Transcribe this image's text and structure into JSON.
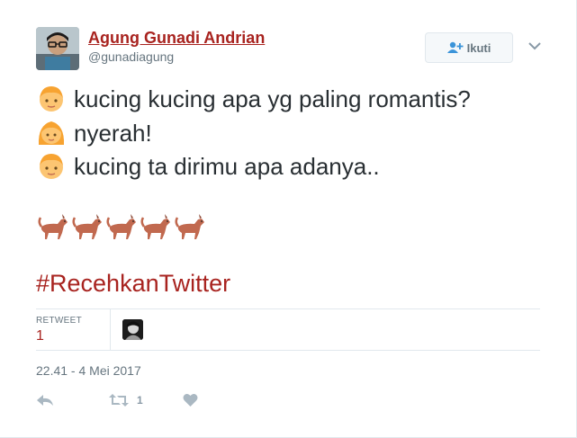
{
  "tweet": {
    "author": {
      "name": "Agung Gunadi Andrian",
      "handle": "@gunadiagung"
    },
    "follow_button": {
      "label": "Ikuti",
      "icon": "add-user-icon"
    },
    "lines": [
      {
        "emoji": "boy-emoji",
        "text": "kucing kucing apa yg paling romantis?"
      },
      {
        "emoji": "girl-emoji",
        "text": "nyerah!"
      },
      {
        "emoji": "boy-emoji",
        "text": "kucing ta dirimu apa adanya.."
      }
    ],
    "dog_emojis": [
      "dog-emoji",
      "dog-emoji",
      "dog-emoji",
      "dog-emoji",
      "dog-emoji"
    ],
    "hashtag": "#RecehkanTwitter",
    "stats": {
      "retweet_label": "RETWEET",
      "retweet_count": "1"
    },
    "timestamp": "22.41 - 4 Mei 2017",
    "actions": {
      "reply_icon": "reply-icon",
      "retweet_icon": "retweet-icon",
      "retweet_count": "1",
      "like_icon": "heart-icon"
    },
    "colors": {
      "link": "#a8231f",
      "muted": "#66757f",
      "action": "#aab8c2"
    }
  }
}
